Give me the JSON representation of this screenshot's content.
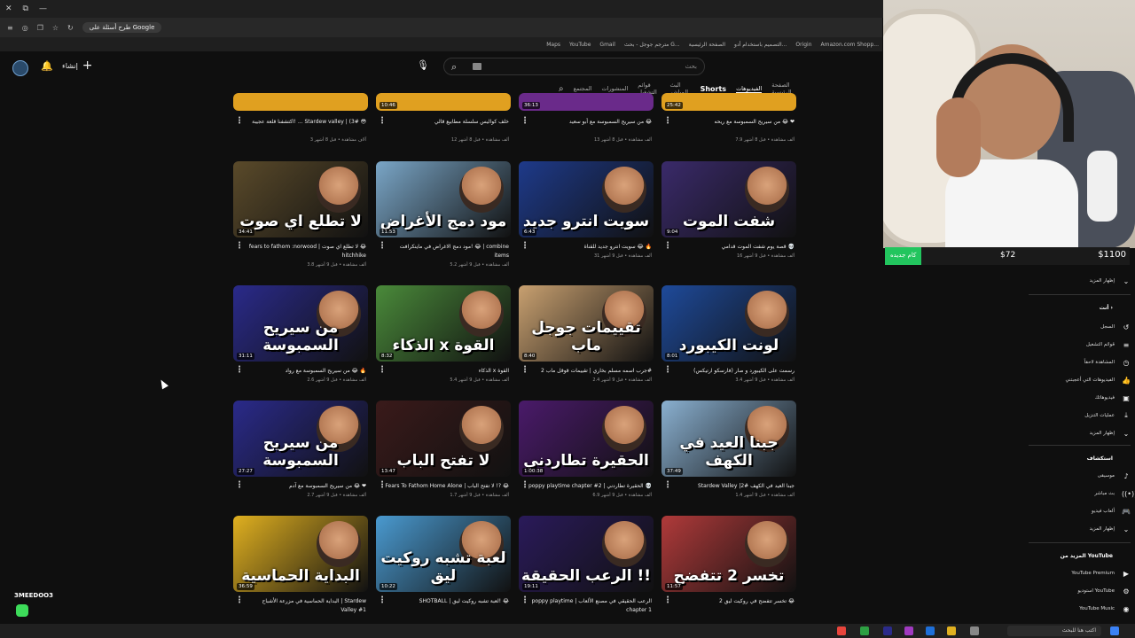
{
  "browser": {
    "window_controls": [
      "✕",
      "⧉",
      "—"
    ],
    "translate_pill": "طرح أسئلة على Google",
    "bookmarks": [
      "Amazon.com Shopp...",
      "Origin",
      "التصميم باستخدام أدو...",
      "الصفحة الرئيسية",
      "مترجم جوجل - بحث G...",
      "Gmail",
      "YouTube",
      "Maps"
    ]
  },
  "header": {
    "create_label": "إنشاء",
    "search_placeholder": "بحث"
  },
  "tabs": {
    "items": [
      "الصفحة الرئيسية",
      "الفيديوهات",
      "Shorts",
      "البث المباشر",
      "قوائم التشغيل",
      "المنشورات",
      "المجتمع"
    ],
    "active": "الفيديوهات"
  },
  "rows_top": [
    {
      "title": "اكتشفنا قلعة عجيبة! ... Stardew valley | (3# 😳",
      "meta": "3 آلاف مشاهدة • قبل 8 أشهر",
      "dur": ""
    },
    {
      "title": "خلف كواليس سلسلة مطابيع قالي",
      "meta": "12 ألف مشاهدة • قبل 8 أشهر",
      "dur": "10:46"
    },
    {
      "title": "من سيريح السمبوسة مع أبو سعيد 😂",
      "meta": "13 ألف مشاهدة • قبل 8 أشهر",
      "dur": "36:13"
    },
    {
      "title": "من سيريح السمبوسة مع ريحه 😂 ❤",
      "meta": "7.9 ألف مشاهدة • قبل 8 أشهر",
      "dur": "25:42"
    }
  ],
  "videos": [
    {
      "caption": "لا تطلع اي صوت",
      "title": "fears to fathom :norwood | لا تطلع اي صوت 😂",
      "meta": "3.8 ألف مشاهدة • قبل 9 أشهر",
      "dur": "34:41",
      "title2": "hitchhike",
      "bg": "#5a4a2a"
    },
    {
      "caption": "مود دمج الأغراض",
      "title": "مود دمج الاغراض في ماينكرافت! 😂 | combine",
      "meta": "5.2 ألف مشاهدة • قبل 9 أشهر",
      "dur": "11:53",
      "title2": "items",
      "bg": "#7aa6c7"
    },
    {
      "caption": "سويت انترو جديد",
      "title": "سويت انترو جديد للقناة 😂 🔥",
      "meta": "31 ألف مشاهدة • قبل 9 أشهر",
      "dur": "6:43",
      "title2": "",
      "bg": "#1e3a8a"
    },
    {
      "caption": "شفت الموت",
      "title": "قصة يوم شفت الموت قدامي 💀",
      "meta": "16 ألف مشاهدة • قبل 9 أشهر",
      "dur": "9:04",
      "title2": "",
      "bg": "#3a2a6a"
    },
    {
      "caption": "من سيريح السمبوسة",
      "title": "من سيريح السمبوسة مع رواد 😂 🔥",
      "meta": "2.6 ألف مشاهدة • قبل 9 أشهر",
      "dur": "31:11",
      "title2": "",
      "bg": "#2a2a8a"
    },
    {
      "caption": "الذكاء x القوة",
      "title": "الذكاء x القوة",
      "meta": "5.4 ألف مشاهدة • قبل 9 أشهر",
      "dur": "8:32",
      "title2": "",
      "bg": "#4a8a3a"
    },
    {
      "caption": "تقييمات جوجل ماب",
      "title": "جرب اسمه مسلم بخاري | تقييمات قوقل ماب 2#",
      "meta": "2.4 ألف مشاهدة • قبل 9 أشهر",
      "dur": "8:40",
      "title2": "",
      "bg": "#c8a070"
    },
    {
      "caption": "لونت الكيبورد",
      "title": "رسمت على الكيبورد و صار (فارسكو ارتيكس)",
      "meta": "3.4 ألف مشاهدة • قبل 9 أشهر",
      "dur": "8:01",
      "title2": "",
      "bg": "#1e4a9a"
    },
    {
      "caption": "من سيريح السمبوسة",
      "title": "من سيريح السمبوسة مع آدم 😂 ❤",
      "meta": "2.7 ألف مشاهدة • قبل 9 أشهر",
      "dur": "27:27",
      "title2": "",
      "bg": "#2a2a8a"
    },
    {
      "caption": "لا تفتح الباب",
      "title": "Fears To Fathom Home Alone | لا تفتح الباب !? 😂",
      "meta": "1.7 ألف مشاهدة • قبل 9 أشهر",
      "dur": "13:47",
      "title2": "",
      "bg": "#3a1a1a"
    },
    {
      "caption": "الحقيرة تطاردني",
      "title": "poppy playtime chapter #2 | الحقيرة تطاردني 💀",
      "meta": "6.9 ألف مشاهدة • قبل 9 أشهر",
      "dur": "1:00:38",
      "title2": "",
      "bg": "#4a1a6a"
    },
    {
      "caption": "جبنا العيد في الكهف",
      "title": "Stardew Valley |2# جبنا العيد في الكهف",
      "meta": "1.4 ألف مشاهدة • قبل 9 أشهر",
      "dur": "37:49",
      "title2": "",
      "bg": "#8ab0d0"
    },
    {
      "caption": "البداية الحماسية",
      "title": "البداية الحماسية في مزرعة الأشباح | Stardew",
      "meta": "",
      "dur": "36:59",
      "title2": "Valley #1",
      "bg": "#e0b020"
    },
    {
      "caption": "لعبة تشبه روكيت ليق",
      "title": "SHOTBALL | لعبة تشبه روكيت ليق! 😂",
      "meta": "",
      "dur": "10:22",
      "title2": "",
      "bg": "#4a9ad0"
    },
    {
      "caption": "الرعب الحقيقة !!",
      "title": "poppy playtime | الرعب الحقيقي في مصنع الألعاب",
      "meta": "",
      "dur": "19:11",
      "title2": "chapter 1",
      "bg": "#2a1a5a"
    },
    {
      "caption": "تخسر 2 تتفضح",
      "title": "تخسر تتفضح في روكيت ليق 2 😂",
      "meta": "",
      "dur": "11:57",
      "title2": "",
      "bg": "#b03a3a"
    }
  ],
  "goal": {
    "label": "كام جديده",
    "current": "$72",
    "total": "$1100",
    "progress": 0.065
  },
  "sidebar": {
    "show_more": "إظهار المزيد",
    "you_header": "أنت",
    "you_items": [
      "السجل",
      "قوائم التشغيل",
      "المشاهدة لاحقاً",
      "الفيديوهات التي أعجبتني",
      "فيديوهاتك",
      "عمليات التنزيل",
      "إظهار المزيد"
    ],
    "explore_header": "استكشاف",
    "explore_items": [
      "موسيقى",
      "بث مباشر",
      "ألعاب فيديو",
      "إظهار المزيد"
    ],
    "more_header": "المزيد من YouTube",
    "more_items": [
      "YouTube Premium",
      "استوديو YouTube",
      "YouTube Music"
    ]
  },
  "chat": {
    "name": "3MEEDOO3"
  },
  "taskbar": {
    "search_placeholder": "اكتب هنا للبحث"
  }
}
